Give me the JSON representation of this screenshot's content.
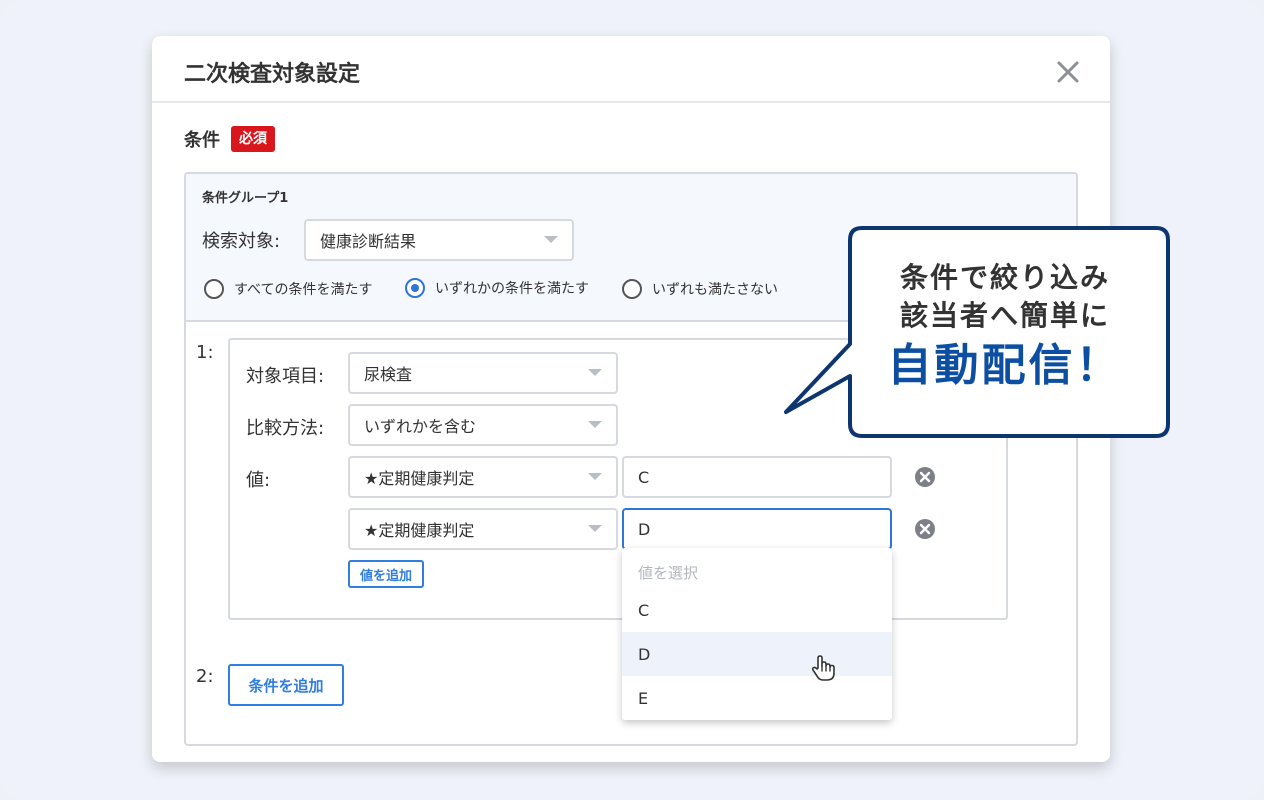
{
  "dialog": {
    "title": "二次検査対象設定",
    "condition_label": "条件",
    "required_badge": "必須"
  },
  "group": {
    "name": "条件グループ1",
    "search_target_label": "検索対象:",
    "search_target_value": "健康診断結果",
    "match_options": [
      {
        "label": "すべての条件を満たす",
        "selected": false
      },
      {
        "label": "いずれかの条件を満たす",
        "selected": true
      },
      {
        "label": "いずれも満たさない",
        "selected": false
      }
    ]
  },
  "condition1": {
    "index": "1:",
    "item_label": "対象項目:",
    "item_value": "尿検査",
    "method_label": "比較方法:",
    "method_value": "いずれかを含む",
    "value_label": "値:",
    "values": [
      {
        "field": "★定期健康判定",
        "value": "C"
      },
      {
        "field": "★定期健康判定",
        "value": "D"
      }
    ],
    "add_value_button": "値を追加"
  },
  "condition2": {
    "index": "2:",
    "add_condition_button": "条件を追加"
  },
  "dropdown": {
    "placeholder": "値を選択",
    "options": [
      "C",
      "D",
      "E"
    ],
    "hovered": "D"
  },
  "callout": {
    "line1": "条件で絞り込み",
    "line2": "該当者へ簡単に",
    "accent": "自動配信！"
  },
  "colors": {
    "accent_blue": "#2f74d8",
    "required_red": "#d9161c",
    "callout_navy": "#0d3670",
    "callout_text_blue": "#0b4ea2"
  }
}
